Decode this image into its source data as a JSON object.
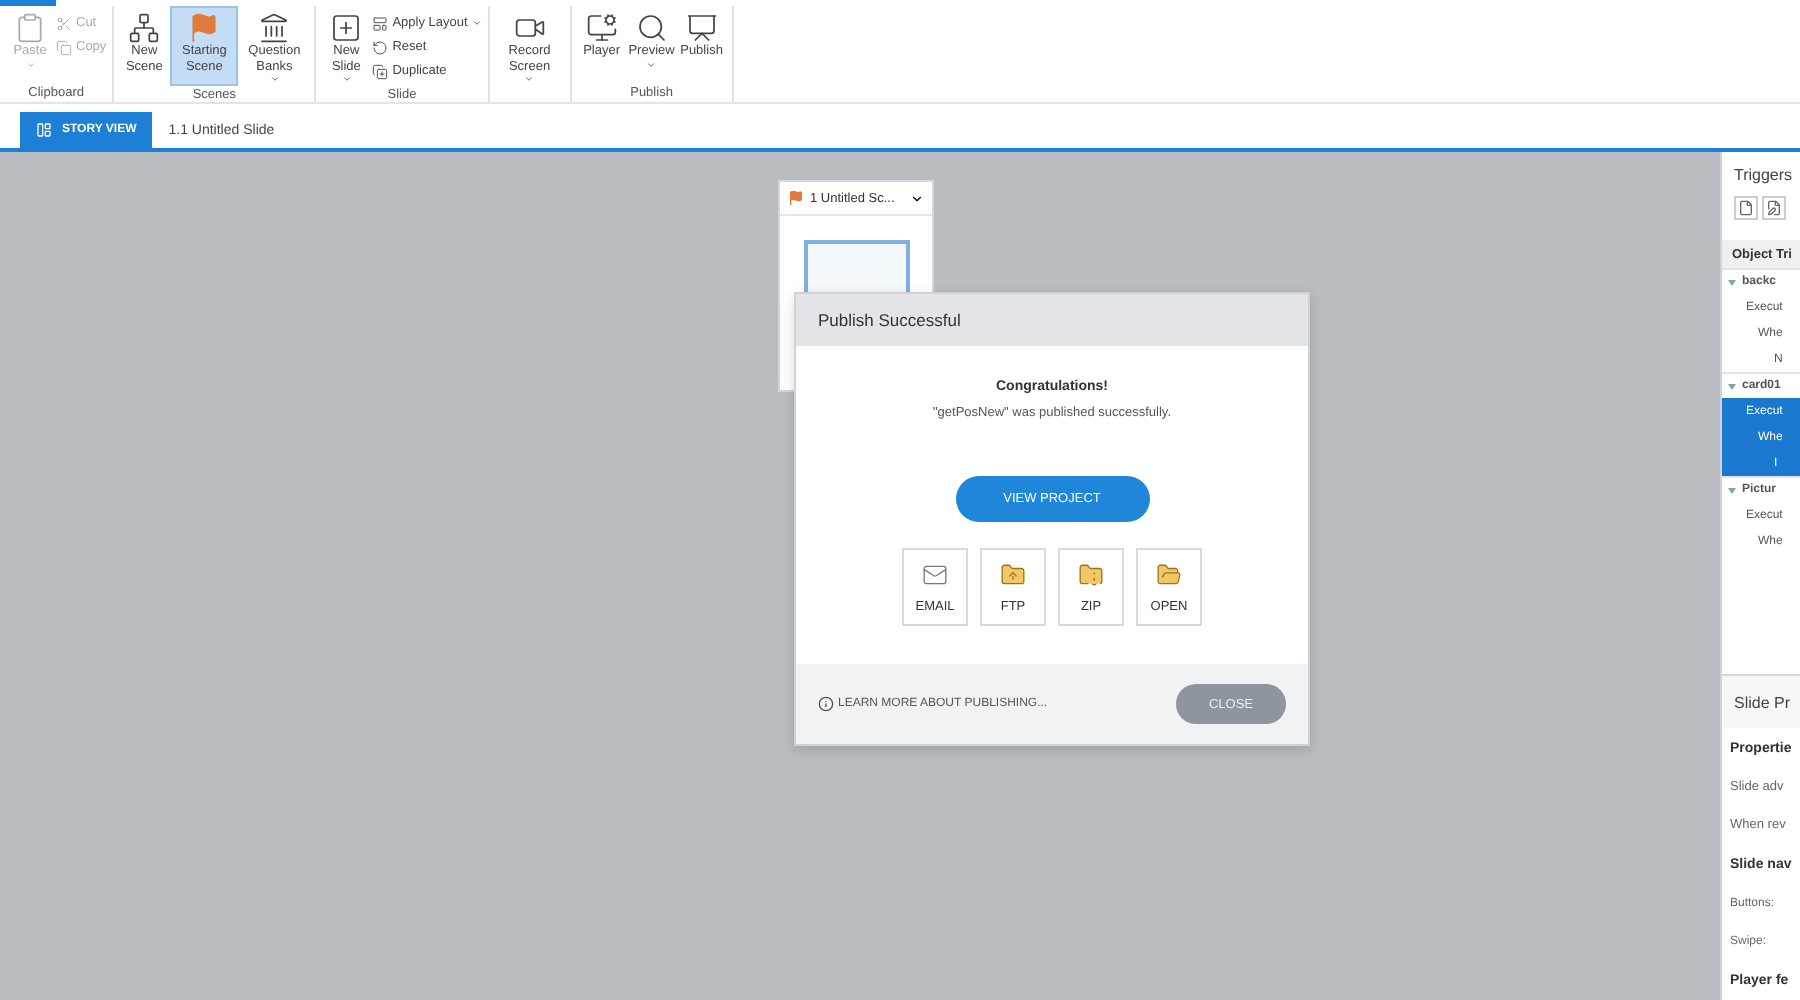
{
  "ribbon": {
    "groups": [
      {
        "label": "Clipboard",
        "items": [
          {
            "kind": "large",
            "label": "Paste",
            "dropdown": true,
            "disabled": true,
            "active": false
          },
          {
            "kind": "small",
            "label": "Cut",
            "dropdown": false,
            "disabled": true
          },
          {
            "kind": "small",
            "label": "Copy",
            "dropdown": false,
            "disabled": true
          }
        ]
      },
      {
        "label": "Scenes",
        "items": [
          {
            "kind": "large",
            "label": "New Scene",
            "dropdown": false,
            "disabled": false,
            "active": false
          },
          {
            "kind": "large",
            "label": "Starting Scene",
            "dropdown": false,
            "disabled": false,
            "active": true
          },
          {
            "kind": "large",
            "label": "Question Banks",
            "dropdown": true,
            "disabled": false,
            "active": false
          }
        ]
      },
      {
        "label": "Slide",
        "items": [
          {
            "kind": "large",
            "label": "New Slide",
            "dropdown": true,
            "disabled": false,
            "active": false
          },
          {
            "kind": "small",
            "label": "Apply Layout",
            "dropdown": true,
            "disabled": false
          },
          {
            "kind": "small",
            "label": "Reset",
            "dropdown": false,
            "disabled": false
          },
          {
            "kind": "small",
            "label": "Duplicate",
            "dropdown": false,
            "disabled": false
          }
        ]
      },
      {
        "items": [
          {
            "kind": "large",
            "label": "Record Screen",
            "dropdown": true,
            "disabled": false,
            "active": false
          }
        ]
      },
      {
        "label": "Publish",
        "items": [
          {
            "kind": "large",
            "label": "Player",
            "dropdown": false,
            "disabled": false,
            "active": false
          },
          {
            "kind": "large",
            "label": "Preview",
            "dropdown": true,
            "disabled": false,
            "active": false
          },
          {
            "kind": "large",
            "label": "Publish",
            "dropdown": false,
            "disabled": false,
            "active": false
          }
        ]
      }
    ]
  },
  "tabs": [
    {
      "label": "STORY VIEW",
      "selected": true
    },
    {
      "label": "1.1 Untitled Slide",
      "selected": false
    }
  ],
  "scene_card": {
    "title": "1 Untitled Sc..."
  },
  "dialog": {
    "title": "Publish Successful",
    "heading": "Congratulations!",
    "message": "\"getPosNew\" was published successfully.",
    "primary_button": "VIEW PROJECT",
    "options": [
      {
        "kind": "email",
        "label": "EMAIL"
      },
      {
        "kind": "ftp",
        "label": "FTP"
      },
      {
        "kind": "zip",
        "label": "ZIP"
      },
      {
        "kind": "folder",
        "label": "OPEN"
      }
    ],
    "learn_more": "LEARN MORE ABOUT PUBLISHING...",
    "close_button": "CLOSE"
  },
  "triggers_panel": {
    "title": "Triggers",
    "section": "Object Tri",
    "rows": [
      {
        "kind": "object",
        "label": "backc",
        "expanded": true,
        "selected": false
      },
      {
        "kind": "action",
        "label": "Execut",
        "selected": false
      },
      {
        "kind": "condition",
        "label": "Whe",
        "selected": false
      },
      {
        "kind": "detail",
        "label": "N",
        "selected": false
      },
      {
        "kind": "object",
        "label": "card01",
        "expanded": true,
        "selected": false
      },
      {
        "kind": "action",
        "label": "Execut",
        "selected": true
      },
      {
        "kind": "condition",
        "label": "Whe",
        "selected": true
      },
      {
        "kind": "detail",
        "label": "I",
        "selected": true
      },
      {
        "kind": "object",
        "label": "Pictur",
        "expanded": true,
        "selected": false
      },
      {
        "kind": "action",
        "label": "Execut",
        "selected": false
      },
      {
        "kind": "condition",
        "label": "Whe",
        "selected": false
      }
    ]
  },
  "slide_properties": {
    "title": "Slide Pr",
    "rows": [
      {
        "kind": "heading",
        "label": "Propertie"
      },
      {
        "kind": "text",
        "label": "Slide adv"
      },
      {
        "kind": "text",
        "label": "When rev"
      },
      {
        "kind": "heading",
        "label": "Slide nav"
      },
      {
        "kind": "small",
        "label": "Buttons:"
      },
      {
        "kind": "small",
        "label": "Swipe:"
      },
      {
        "kind": "heading",
        "label": "Player fe"
      }
    ]
  }
}
